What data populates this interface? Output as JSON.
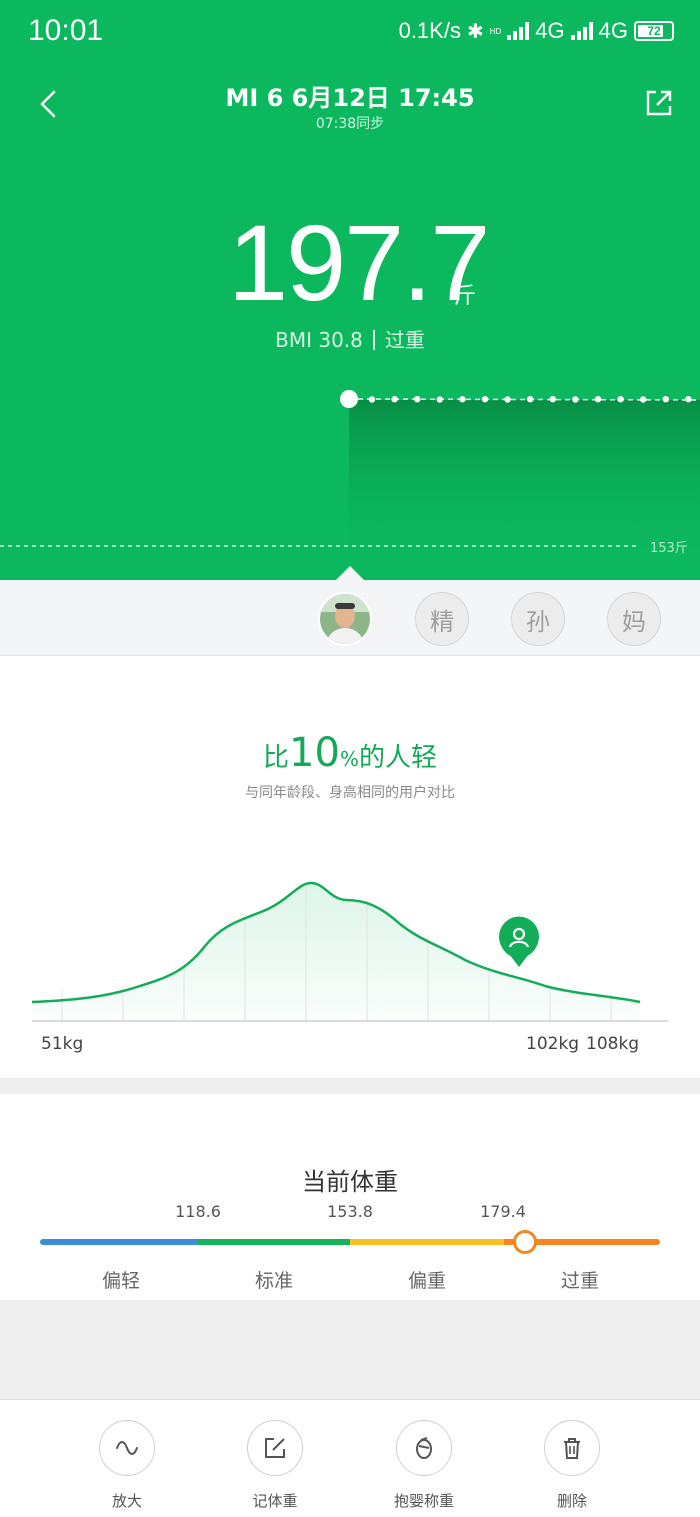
{
  "status_bar": {
    "time": "10:01",
    "net_speed": "0.1K/s",
    "network1": "4G",
    "network2": "4G",
    "battery": "72",
    "hd_badge": "HD"
  },
  "header": {
    "title": "MI 6 6月12日 17:45",
    "sync": "07:38同步"
  },
  "reading": {
    "weight": "197.7",
    "unit": "斤",
    "bmi": "BMI 30.8",
    "status": "过重"
  },
  "trend": {
    "reference_label": "153斤"
  },
  "users": [
    {
      "kind": "photo",
      "label": ""
    },
    {
      "kind": "initial",
      "label": "精"
    },
    {
      "kind": "initial",
      "label": "孙"
    },
    {
      "kind": "initial",
      "label": "妈"
    }
  ],
  "comparison": {
    "prefix": "比",
    "percent": "10",
    "percent_sign": "%",
    "suffix": "的人轻",
    "subtitle": "与同年龄段、身高相同的用户对比",
    "labels": {
      "left": "51kg",
      "mid": "102kg",
      "right": "108kg"
    }
  },
  "current_weight": {
    "title": "当前体重",
    "thresholds": [
      "118.6",
      "153.8",
      "179.4"
    ],
    "categories": [
      "偏轻",
      "标准",
      "偏重",
      "过重"
    ],
    "colors": [
      "#3d8ed8",
      "#13b45b",
      "#f7c122",
      "#f4851f"
    ]
  },
  "toolbar": {
    "zoom": "放大",
    "record": "记体重",
    "baby": "抱婴称重",
    "delete": "删除"
  },
  "colors": {
    "brand": "#0bb85e",
    "accent_text": "#14a857"
  }
}
